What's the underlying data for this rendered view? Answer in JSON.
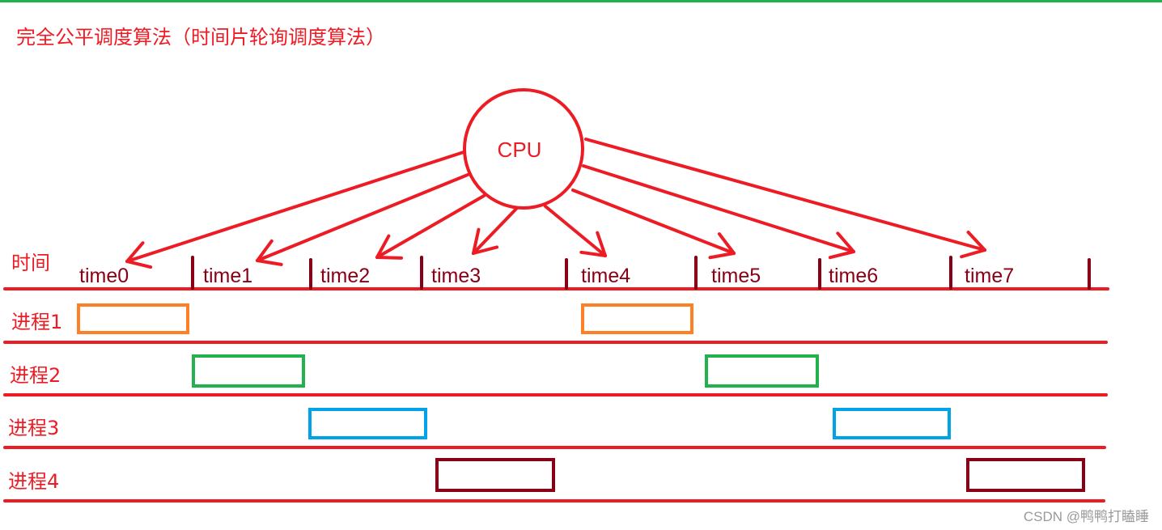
{
  "title": "完全公平调度算法（时间片轮询调度算法）",
  "cpu_label": "CPU",
  "time_row_label": "时间",
  "time_slots": [
    "time0",
    "time1",
    "time2",
    "time3",
    "time4",
    "time5",
    "time6",
    "time7"
  ],
  "processes": [
    {
      "label": "进程1",
      "color": "#ff7f27",
      "slots": [
        0,
        4
      ]
    },
    {
      "label": "进程2",
      "color": "#22b14c",
      "slots": [
        1,
        5
      ]
    },
    {
      "label": "进程3",
      "color": "#00a2e8",
      "slots": [
        2,
        6
      ]
    },
    {
      "label": "进程4",
      "color": "#880015",
      "slots": [
        3,
        7
      ]
    }
  ],
  "colors": {
    "accent": "#ed1c24",
    "tick": "#880015",
    "top_bar": "#22b14c",
    "watermark": "#9a9a9a"
  },
  "watermark": "CSDN @鸭鸭打瞌睡"
}
